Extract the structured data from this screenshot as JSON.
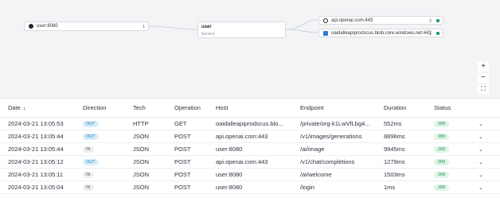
{
  "graph": {
    "client": {
      "label": "user:8080",
      "count": "1"
    },
    "service": {
      "title": "user",
      "subtitle": "Service"
    },
    "targets": [
      {
        "label": "api.openai.com:443",
        "count": "2",
        "icon": "openai-icon"
      },
      {
        "label": "oaidalleapiprodscus.blob.core.windows.net:443",
        "count": "1",
        "icon": "azure-icon"
      }
    ],
    "zoom_in": "+",
    "zoom_out": "−",
    "fit": "⛶"
  },
  "table": {
    "columns": [
      "Date",
      "Direction",
      "Tech",
      "Operation",
      "Host",
      "Endpoint",
      "Duration",
      "Status"
    ],
    "sort_indicator": "↓",
    "rows": [
      {
        "date": "2024-03-21 13:05:53",
        "direction": "OUT",
        "tech": "HTTP",
        "operation": "GET",
        "host": "oaidalleapiprodscus.blo...",
        "endpoint": "/private/org-k1LwVfLbg4...",
        "duration": "552ms",
        "status": "200"
      },
      {
        "date": "2024-03-21 13:05:44",
        "direction": "OUT",
        "tech": "JSON",
        "operation": "POST",
        "host": "api.openai.com:443",
        "endpoint": "/v1/images/generations",
        "duration": "8896ms",
        "status": "200"
      },
      {
        "date": "2024-03-21 13:05:44",
        "direction": "IN",
        "tech": "JSON",
        "operation": "POST",
        "host": "user:8080",
        "endpoint": "/ai/image",
        "duration": "9945ms",
        "status": "200"
      },
      {
        "date": "2024-03-21 13:05:12",
        "direction": "OUT",
        "tech": "JSON",
        "operation": "POST",
        "host": "api.openai.com:443",
        "endpoint": "/v1/chat/completions",
        "duration": "1279ms",
        "status": "200"
      },
      {
        "date": "2024-03-21 13:05:11",
        "direction": "IN",
        "tech": "JSON",
        "operation": "POST",
        "host": "user:8080",
        "endpoint": "/ai/welcome",
        "duration": "1503ms",
        "status": "200"
      },
      {
        "date": "2024-03-21 13:05:04",
        "direction": "IN",
        "tech": "JSON",
        "operation": "POST",
        "host": "user:8080",
        "endpoint": "/login",
        "duration": "1ms",
        "status": "200"
      }
    ],
    "expand_icon": "⌄"
  },
  "colors": {
    "out_badge": "#d8eefa",
    "in_badge": "#edeff1",
    "status_ok": "#dff5e6",
    "edge": "#c7ccd1"
  }
}
